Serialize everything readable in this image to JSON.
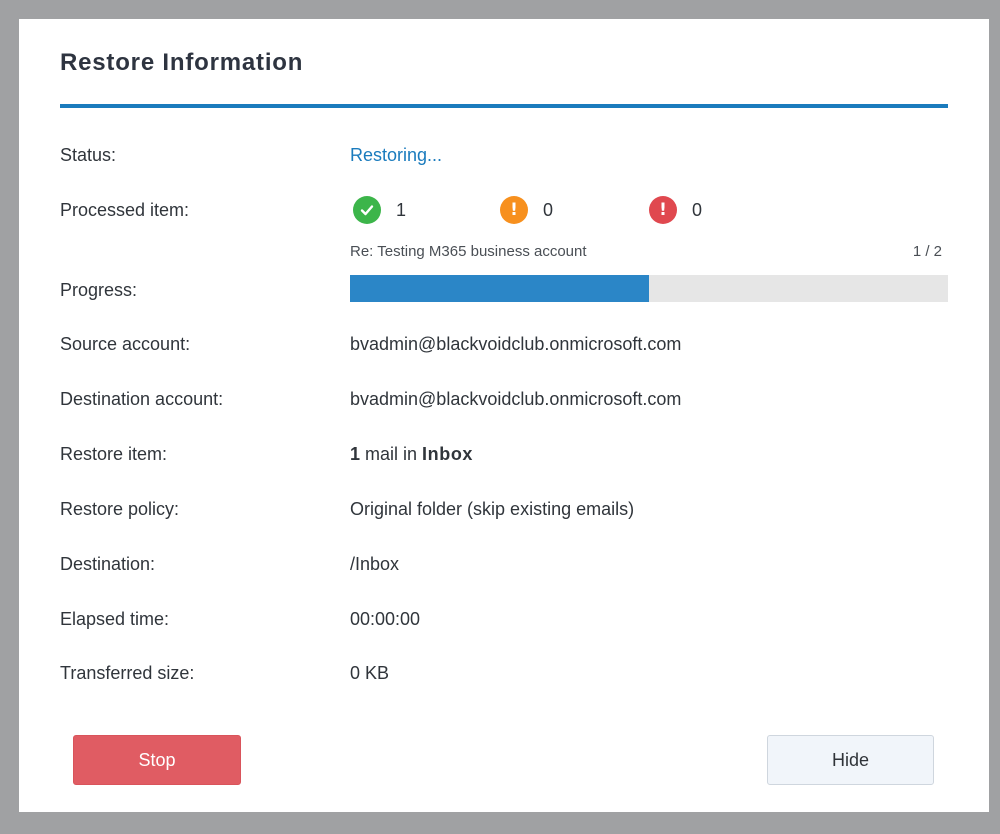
{
  "dialog": {
    "title": "Restore Information"
  },
  "status": {
    "label": "Status:",
    "value": "Restoring..."
  },
  "processed": {
    "label": "Processed item:",
    "success_count": "1",
    "warning_count": "0",
    "error_count": "0",
    "success_icon": "check-circle-icon",
    "warning_icon": "warning-circle-icon",
    "error_icon": "error-circle-icon"
  },
  "progress": {
    "label": "Progress:",
    "current_item": "Re: Testing M365 business account",
    "counter": "1 / 2",
    "fraction": 0.5
  },
  "source_account": {
    "label": "Source account:",
    "value": "bvadmin@blackvoidclub.onmicrosoft.com"
  },
  "destination_account": {
    "label": "Destination account:",
    "value": "bvadmin@blackvoidclub.onmicrosoft.com"
  },
  "restore_item": {
    "label": "Restore item:",
    "count": "1",
    "middle": " mail in ",
    "folder": "Inbox"
  },
  "restore_policy": {
    "label": "Restore policy:",
    "value": "Original folder (skip existing emails)"
  },
  "destination": {
    "label": "Destination:",
    "value": "/Inbox"
  },
  "elapsed_time": {
    "label": "Elapsed time:",
    "value": "00:00:00"
  },
  "transferred_size": {
    "label": "Transferred size:",
    "value": "0 KB"
  },
  "buttons": {
    "stop": "Stop",
    "hide": "Hide"
  },
  "colors": {
    "accent": "#1a7bbd",
    "progress_fill": "#2b86c7",
    "success": "#3cb54a",
    "warning": "#f7901e",
    "error": "#e0484f",
    "stop_button": "#e05c63"
  }
}
